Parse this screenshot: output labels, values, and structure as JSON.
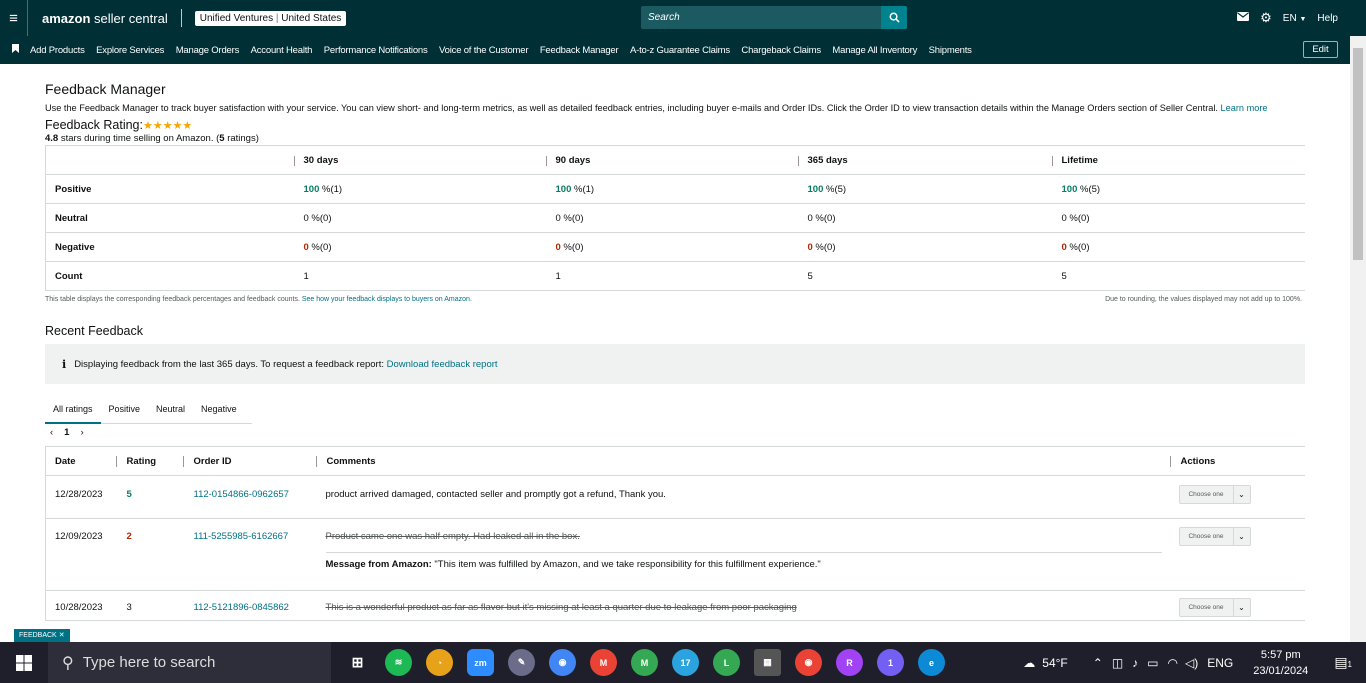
{
  "header": {
    "brand_main": "amazon",
    "brand_rest": " seller central",
    "account_store": "Unified Ventures",
    "account_sep": " | ",
    "account_country": "United States",
    "search_placeholder": "Search",
    "lang": "EN",
    "help": "Help"
  },
  "nav": {
    "items": [
      "Add Products",
      "Explore Services",
      "Manage Orders",
      "Account Health",
      "Performance Notifications",
      "Voice of the Customer",
      "Feedback Manager",
      "A-to-z Guarantee Claims",
      "Chargeback Claims",
      "Manage All Inventory",
      "Shipments"
    ],
    "edit": "Edit"
  },
  "page": {
    "title": "Feedback Manager",
    "intro": "Use the Feedback Manager to track buyer satisfaction with your service. You can view short- and long-term metrics, as well as detailed feedback entries, including buyer e-mails and Order IDs. Click the Order ID to view transaction details within the Manage Orders section of Seller Central.",
    "learn_more": "Learn more",
    "rating_label": "Feedback Rating:",
    "rating_value": "4.8",
    "rating_text": " stars during time selling on Amazon. (",
    "rating_count": "5",
    "rating_suffix": " ratings)"
  },
  "metrics": {
    "columns": [
      "30 days",
      "90 days",
      "365 days",
      "Lifetime"
    ],
    "rows": {
      "positive": {
        "label": "Positive",
        "values": [
          [
            "100",
            " %(1)"
          ],
          [
            "100",
            " %(1)"
          ],
          [
            "100",
            " %(5)"
          ],
          [
            "100",
            " %(5)"
          ]
        ]
      },
      "neutral": {
        "label": "Neutral",
        "values": [
          "0 %(0)",
          "0 %(0)",
          "0 %(0)",
          "0 %(0)"
        ]
      },
      "negative": {
        "label": "Negative",
        "values": [
          [
            "0",
            " %(0)"
          ],
          [
            "0",
            " %(0)"
          ],
          [
            "0",
            " %(0)"
          ],
          [
            "0",
            " %(0)"
          ]
        ]
      },
      "count": {
        "label": "Count",
        "values": [
          "1",
          "1",
          "5",
          "5"
        ]
      }
    },
    "note_left_text": "This table displays the corresponding feedback percentages and feedback counts. ",
    "note_left_link": "See how your feedback displays to buyers on Amazon.",
    "note_right": "Due to rounding, the values displayed may not add up to 100%."
  },
  "recent": {
    "title": "Recent Feedback",
    "info_text": "Displaying feedback from the last 365 days. To request a feedback report: ",
    "info_link": "Download feedback report",
    "tabs": [
      "All ratings",
      "Positive",
      "Neutral",
      "Negative"
    ],
    "page": "1",
    "columns": [
      "Date",
      "Rating",
      "Order ID",
      "Comments",
      "Actions"
    ],
    "choose": "Choose one",
    "rows": [
      {
        "date": "12/28/2023",
        "rating": "5",
        "order": "112-0154866-0962657",
        "comment": "product arrived damaged, contacted seller and promptly got a refund, Thank you."
      },
      {
        "date": "12/09/2023",
        "rating": "2",
        "order": "111-5255985-6162667",
        "comment": "Product came one was half empty. Had leaked all in the box.",
        "msg_label": "Message from Amazon:",
        "msg_text": " \"This item was fulfilled by Amazon, and we take responsibility for this fulfillment experience.\""
      },
      {
        "date": "10/28/2023",
        "rating": "3",
        "order": "112-5121896-0845862",
        "comment": "This is a wonderful product as far as flavor but it's missing at least a quarter due to leakage from poor packaging"
      }
    ]
  },
  "feedback_tag": "FEEDBACK",
  "taskbar": {
    "search": "Type here to search",
    "weather": "54°F",
    "lang": "ENG",
    "time": "5:57 pm",
    "date": "23/01/2024",
    "telegram_badge": "17",
    "viber_badge": "1",
    "notif_badge": "1"
  }
}
